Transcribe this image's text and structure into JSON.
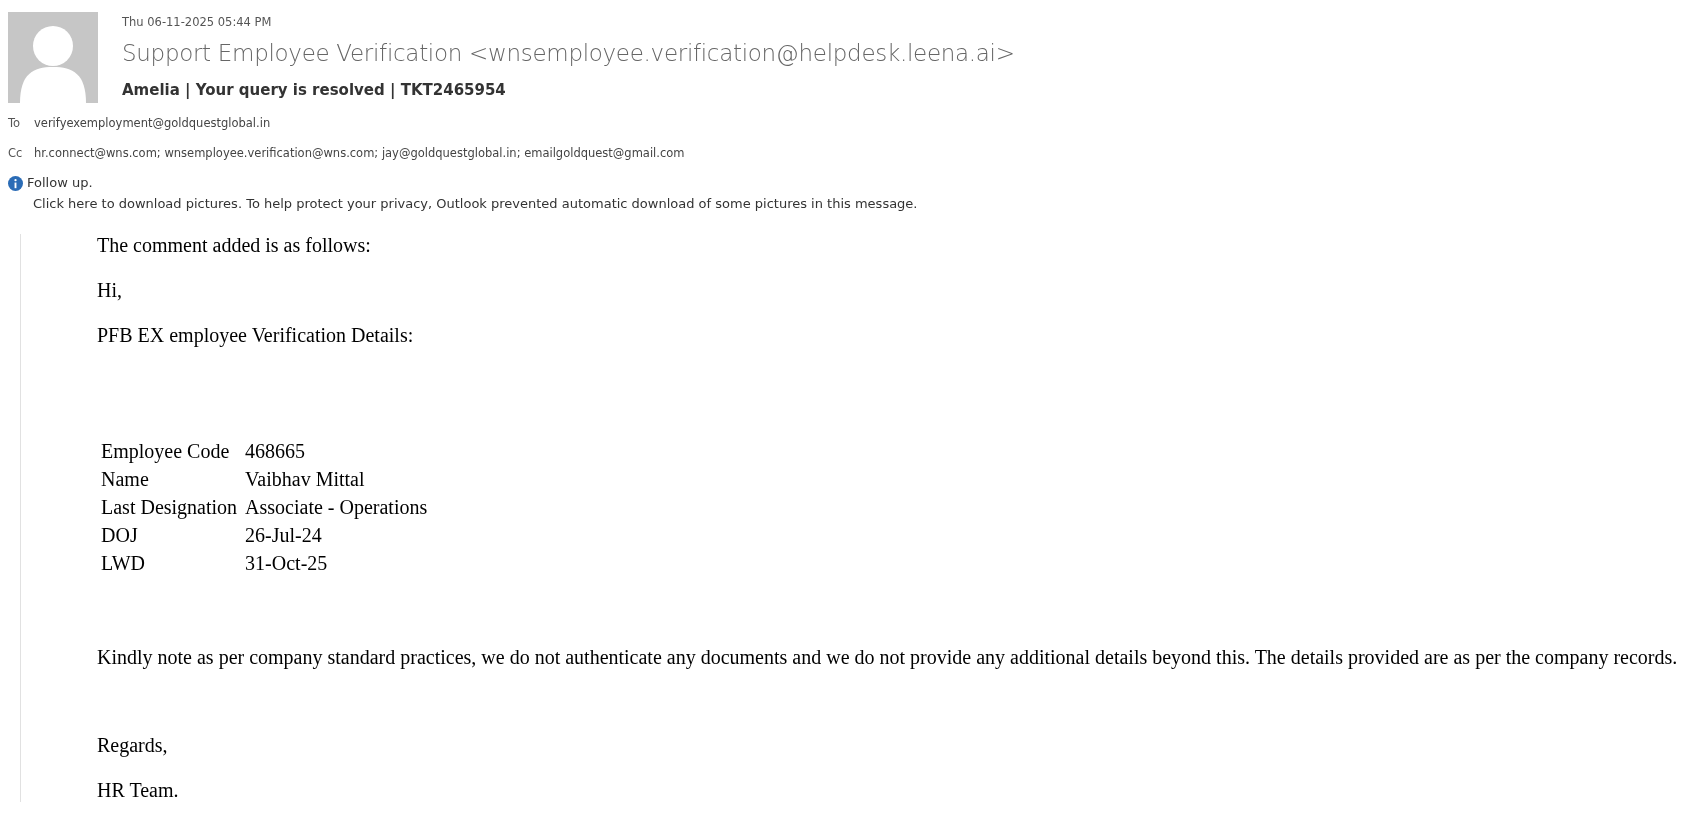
{
  "header": {
    "date": "Thu 06-11-2025 05:44 PM",
    "sender": "Support Employee Verification <wnsemployee.verification@helpdesk.leena.ai>",
    "subject": "Amelia | Your query is resolved | TKT2465954",
    "recipients": [
      {
        "label": "To",
        "value": "verifyexemployment@goldquestglobal.in"
      },
      {
        "label": "Cc",
        "value": "hr.connect@wns.com; wnsemployee.verification@wns.com; jay@goldquestglobal.in; emailgoldquest@gmail.com"
      }
    ],
    "info": {
      "flag": "Follow up.",
      "notice": "Click here to download pictures. To help protect your privacy, Outlook prevented automatic download of some pictures in this message."
    }
  },
  "body": {
    "intro": [
      "The comment added is as follows:",
      "Hi,",
      "PFB EX employee Verification Details:"
    ],
    "details": [
      {
        "field": "Employee Code",
        "value": "468665"
      },
      {
        "field": "Name",
        "value": "Vaibhav Mittal"
      },
      {
        "field": "Last Designation",
        "value": "Associate - Operations"
      },
      {
        "field": "DOJ",
        "value": "26-Jul-24"
      },
      {
        "field": "LWD",
        "value": "31-Oct-25"
      }
    ],
    "note": "Kindly note as per company standard practices, we do not authenticate any documents and we do not provide any additional details beyond this. The details provided are as per the company records.",
    "closing": [
      "Regards,",
      "HR Team."
    ]
  }
}
